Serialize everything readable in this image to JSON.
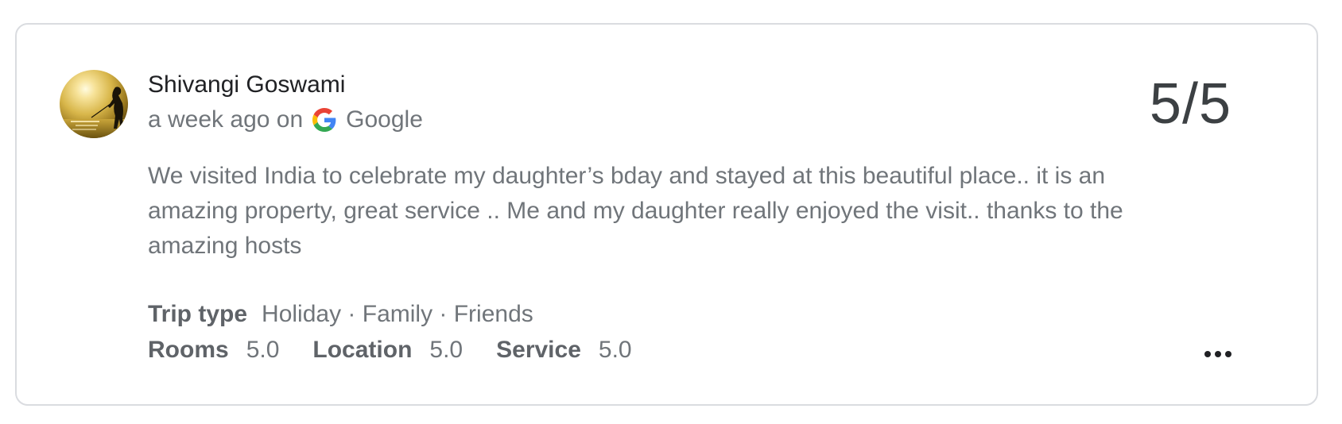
{
  "review": {
    "reviewer_name": "Shivangi Goswami",
    "time_ago": "a week ago on",
    "source": "Google",
    "rating": "5/5",
    "text": "We visited India to celebrate my daughter’s bday and stayed at this beautiful place.. it is an amazing property, great service .. Me and my daughter really enjoyed the visit.. thanks to the amazing hosts",
    "trip_type_label": "Trip type",
    "trip_type_value": "Holiday · Family · Friends",
    "scores": [
      {
        "label": "Rooms",
        "value": "5.0"
      },
      {
        "label": "Location",
        "value": "5.0"
      },
      {
        "label": "Service",
        "value": "5.0"
      }
    ]
  },
  "icons": {
    "avatar": "avatar-sunset-photo",
    "source_icon": "google-logo-icon",
    "more": "more-horizontal-icon"
  },
  "colors": {
    "card_border": "#dadce0",
    "name_text": "#202124",
    "secondary_text": "#70757a",
    "rating_text": "#3c4043"
  }
}
